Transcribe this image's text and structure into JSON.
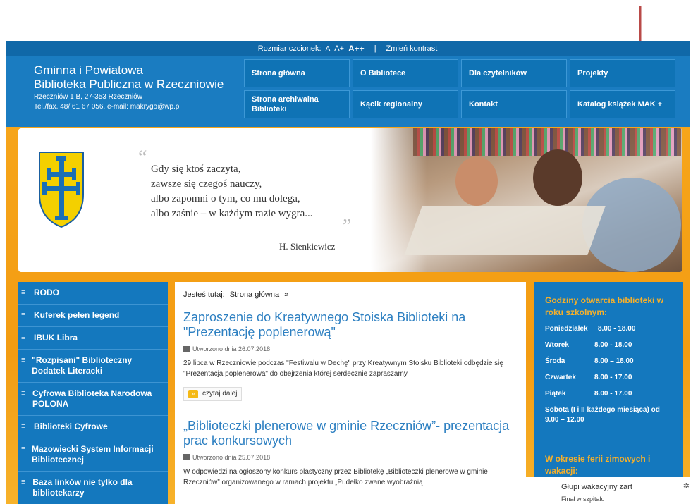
{
  "topbar": {
    "font_size_label": "Rozmiar czcionek:",
    "size_small": "A",
    "size_medium": "A+",
    "size_large": "A++",
    "separator": "|",
    "contrast_label": "Zmień kontrast"
  },
  "brand": {
    "line1": "Gminna i Powiatowa",
    "line2": "Biblioteka Publiczna w Rzeczniowie",
    "address": "Rzeczniów 1 B, 27-353 Rzeczniów",
    "contact": "Tel./fax. 48/ 61 67 056, e-mail: makrygo@wp.pl"
  },
  "nav": {
    "items": [
      {
        "label": "Strona główna"
      },
      {
        "label": "O Bibliotece"
      },
      {
        "label": "Dla czytelników"
      },
      {
        "label": "Projekty"
      },
      {
        "label": "Strona archiwalna Biblioteki"
      },
      {
        "label": "Kącik regionalny"
      },
      {
        "label": "Kontakt"
      },
      {
        "label": "Katalog książek MAK +"
      }
    ]
  },
  "banner": {
    "quote_open": "“",
    "quote_lines": [
      "Gdy się ktoś zaczyta,",
      "zawsze się czegoś nauczy,",
      "albo zapomni o tym, co mu dolega,",
      "albo zaśnie – w każdym razie wygra..."
    ],
    "quote_close": "”",
    "author": "H. Sienkiewicz"
  },
  "leftnav": {
    "items": [
      {
        "label": "RODO"
      },
      {
        "label": "Kuferek pełen legend"
      },
      {
        "label": "IBUK Libra"
      },
      {
        "label": "\"Rozpisani\" Biblioteczny Dodatek Literacki"
      },
      {
        "label": "Cyfrowa Biblioteka Narodowa POLONA"
      },
      {
        "label": "Biblioteki Cyfrowe"
      },
      {
        "label": "Mazowiecki System Informacji Bibliotecznej"
      },
      {
        "label": "Baza linków nie tylko dla bibliotekarzy"
      }
    ]
  },
  "breadcrumb": {
    "label": "Jesteś tutaj:",
    "current": "Strona główna",
    "arrow": "»"
  },
  "articles": [
    {
      "title": "Zaproszenie do Kreatywnego Stoiska Biblioteki na \"Prezentację poplenerową\"",
      "date": "Utworzono dnia 26.07.2018",
      "text": "29 lipca w Rzeczniowie podczas \"Festiwalu w Dechę\" przy Kreatywnym Stoisku Biblioteki odbędzie się \"Prezentacja poplenerowa\" do obejrzenia której serdecznie zapraszamy.",
      "readmore": "czytaj dalej",
      "readmore_icon": "»"
    },
    {
      "title": "„Biblioteczki plenerowe w gminie Rzeczniów”- prezentacja prac konkursowych",
      "date": "Utworzono dnia 25.07.2018",
      "text": "W odpowiedzi na ogłoszony konkurs plastyczny przez Bibliotekę „Biblioteczki plenerowe w gminie Rzeczniów” organizowanego w ramach projektu „Pudełko zwane wyobraźnią"
    }
  ],
  "hours": {
    "heading": "Godziny otwarcia biblioteki w roku szkolnym:",
    "rows": [
      {
        "day": "Poniedziałek",
        "time": "8.00 - 18.00"
      },
      {
        "day": "Wtorek",
        "time": "8.00 - 18.00"
      },
      {
        "day": "Środa",
        "time": "8.00 – 18.00"
      },
      {
        "day": "Czwartek",
        "time": "8.00 - 17.00"
      },
      {
        "day": "Piątek",
        "time": "8.00 - 17.00"
      }
    ],
    "saturday": "Sobota (I i II każdego miesiąca) od 9.00 – 12.00",
    "holiday_heading": "W okresie ferii zimowych i wakacji:"
  },
  "popup": {
    "title": "Głupi wakacyjny żart",
    "subtitle": "Finał w szpitalu",
    "gear_glyph": "✲"
  },
  "colors": {
    "header_blue": "#1a7cc1",
    "topbar_blue": "#1068a8",
    "orange": "#f39c12",
    "link_blue": "#2c7fc1",
    "hours_heading": "#f6b02b",
    "arrow_red": "#b94a48"
  }
}
